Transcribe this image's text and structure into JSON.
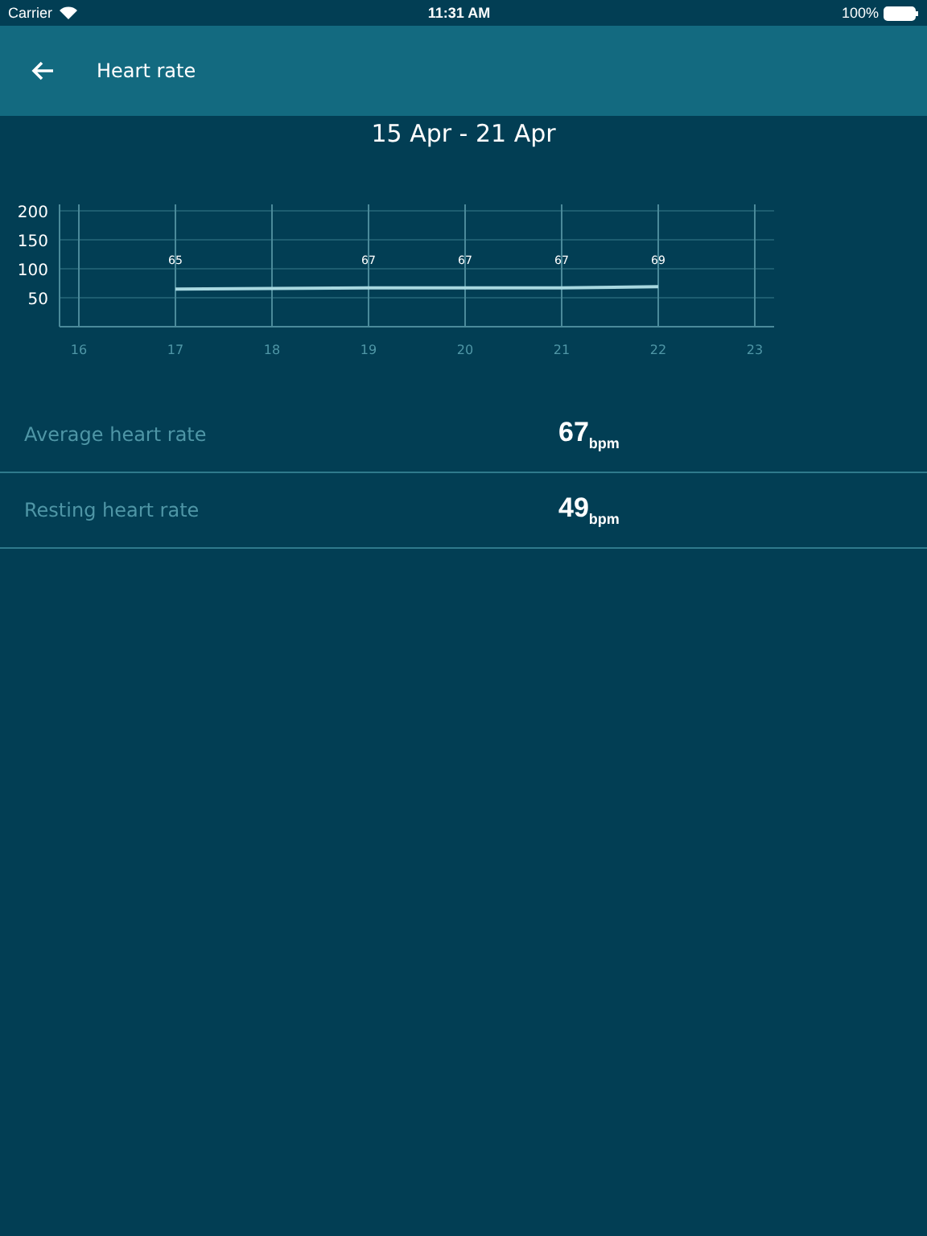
{
  "status_bar": {
    "carrier": "Carrier",
    "time": "11:31 AM",
    "battery": "100%"
  },
  "header": {
    "title": "Heart rate"
  },
  "date_range": "15 Apr - 21 Apr",
  "chart_data": {
    "type": "line",
    "x": [
      17,
      19,
      20,
      21,
      22
    ],
    "series": [
      {
        "color": "#a8d8e0",
        "values": [
          65,
          67,
          67,
          67,
          69
        ]
      }
    ],
    "xlim": [
      16,
      23
    ],
    "ylim": [
      0,
      200
    ],
    "xticks": [
      16,
      17,
      18,
      19,
      20,
      21,
      22,
      23
    ],
    "yticks": [
      50,
      100,
      150,
      200
    ],
    "data_labels": true,
    "grid": true
  },
  "stats": [
    {
      "label": "Average heart rate",
      "value": "67$_{bpm}$"
    },
    {
      "label": "Resting heart rate",
      "value": "49$_{bpm}$"
    }
  ]
}
